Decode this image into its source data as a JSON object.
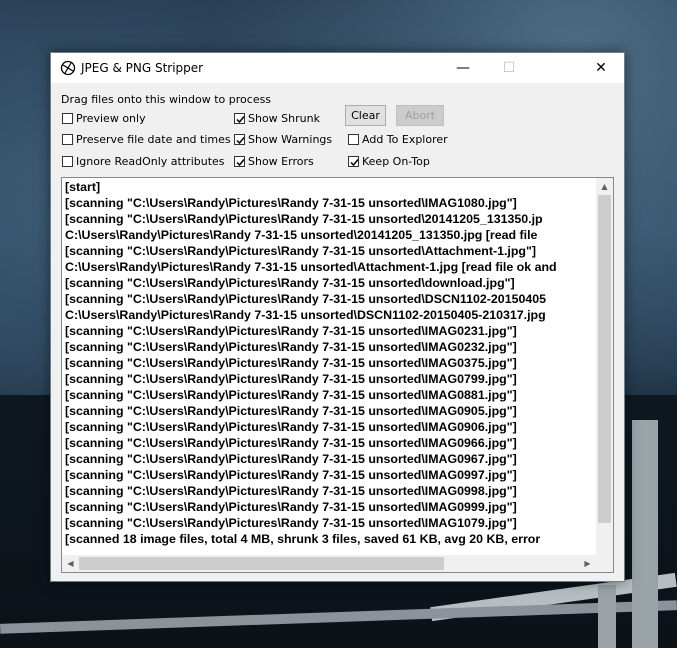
{
  "window": {
    "title": "JPEG & PNG Stripper",
    "minimize_glyph": "—",
    "maximize_glyph": "☐",
    "close_glyph": "✕"
  },
  "instructions": "Drag files onto this window to process",
  "options": {
    "preview_only": {
      "label": "Preview only",
      "checked": false
    },
    "preserve_date": {
      "label": "Preserve file date and times",
      "checked": false
    },
    "ignore_readonly": {
      "label": "Ignore ReadOnly attributes",
      "checked": false
    },
    "show_shrunk": {
      "label": "Show Shrunk",
      "checked": true
    },
    "show_warnings": {
      "label": "Show Warnings",
      "checked": true
    },
    "show_errors": {
      "label": "Show Errors",
      "checked": true
    },
    "add_to_explorer": {
      "label": "Add To Explorer",
      "checked": false
    },
    "keep_on_top": {
      "label": "Keep On-Top",
      "checked": true
    }
  },
  "buttons": {
    "clear": "Clear",
    "abort": "Abort"
  },
  "log": [
    "[start]",
    "[scanning \"C:\\Users\\Randy\\Pictures\\Randy 7-31-15 unsorted\\IMAG1080.jpg\"]",
    "[scanning \"C:\\Users\\Randy\\Pictures\\Randy 7-31-15 unsorted\\20141205_131350.jp",
    "C:\\Users\\Randy\\Pictures\\Randy 7-31-15 unsorted\\20141205_131350.jpg [read file",
    "[scanning \"C:\\Users\\Randy\\Pictures\\Randy 7-31-15 unsorted\\Attachment-1.jpg\"]",
    "C:\\Users\\Randy\\Pictures\\Randy 7-31-15 unsorted\\Attachment-1.jpg [read file ok and",
    "[scanning \"C:\\Users\\Randy\\Pictures\\Randy 7-31-15 unsorted\\download.jpg\"]",
    "[scanning \"C:\\Users\\Randy\\Pictures\\Randy 7-31-15 unsorted\\DSCN1102-20150405",
    "C:\\Users\\Randy\\Pictures\\Randy 7-31-15 unsorted\\DSCN1102-20150405-210317.jpg",
    "[scanning \"C:\\Users\\Randy\\Pictures\\Randy 7-31-15 unsorted\\IMAG0231.jpg\"]",
    "[scanning \"C:\\Users\\Randy\\Pictures\\Randy 7-31-15 unsorted\\IMAG0232.jpg\"]",
    "[scanning \"C:\\Users\\Randy\\Pictures\\Randy 7-31-15 unsorted\\IMAG0375.jpg\"]",
    "[scanning \"C:\\Users\\Randy\\Pictures\\Randy 7-31-15 unsorted\\IMAG0799.jpg\"]",
    "[scanning \"C:\\Users\\Randy\\Pictures\\Randy 7-31-15 unsorted\\IMAG0881.jpg\"]",
    "[scanning \"C:\\Users\\Randy\\Pictures\\Randy 7-31-15 unsorted\\IMAG0905.jpg\"]",
    "[scanning \"C:\\Users\\Randy\\Pictures\\Randy 7-31-15 unsorted\\IMAG0906.jpg\"]",
    "[scanning \"C:\\Users\\Randy\\Pictures\\Randy 7-31-15 unsorted\\IMAG0966.jpg\"]",
    "[scanning \"C:\\Users\\Randy\\Pictures\\Randy 7-31-15 unsorted\\IMAG0967.jpg\"]",
    "[scanning \"C:\\Users\\Randy\\Pictures\\Randy 7-31-15 unsorted\\IMAG0997.jpg\"]",
    "[scanning \"C:\\Users\\Randy\\Pictures\\Randy 7-31-15 unsorted\\IMAG0998.jpg\"]",
    "[scanning \"C:\\Users\\Randy\\Pictures\\Randy 7-31-15 unsorted\\IMAG0999.jpg\"]",
    "[scanning \"C:\\Users\\Randy\\Pictures\\Randy 7-31-15 unsorted\\IMAG1079.jpg\"]",
    "[scanned 18 image files, total 4 MB, shrunk 3 files, saved 61 KB, avg 20 KB, error"
  ]
}
